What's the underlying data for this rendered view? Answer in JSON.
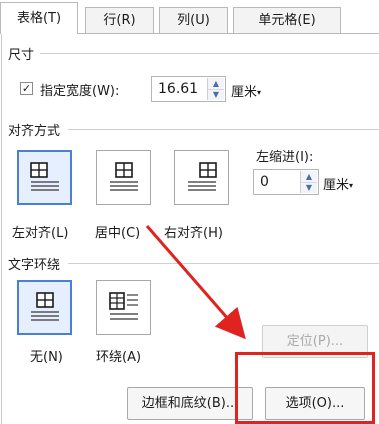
{
  "tabs": [
    {
      "label": "表格(T)"
    },
    {
      "label": "行(R)"
    },
    {
      "label": "列(U)"
    },
    {
      "label": "单元格(E)"
    }
  ],
  "size": {
    "section_label": "尺寸",
    "checkbox_checked": true,
    "checkbox_mark": "✓",
    "width_label": "指定宽度(W):",
    "width_value": "16.61",
    "width_unit": "厘米"
  },
  "alignment": {
    "section_label": "对齐方式",
    "options": [
      {
        "label": "左对齐(L)"
      },
      {
        "label": "居中(C)"
      },
      {
        "label": "右对齐(H)"
      }
    ],
    "indent_label": "左缩进(I):",
    "indent_value": "0",
    "indent_unit": "厘米"
  },
  "wrapping": {
    "section_label": "文字环绕",
    "options": [
      {
        "label": "无(N)"
      },
      {
        "label": "环绕(A)"
      }
    ]
  },
  "buttons": {
    "position": "定位(P)...",
    "borders": "边框和底纹(B)...",
    "options": "选项(O)..."
  },
  "colors": {
    "accent": "#4a7fd6",
    "annotation": "#e0231f"
  }
}
